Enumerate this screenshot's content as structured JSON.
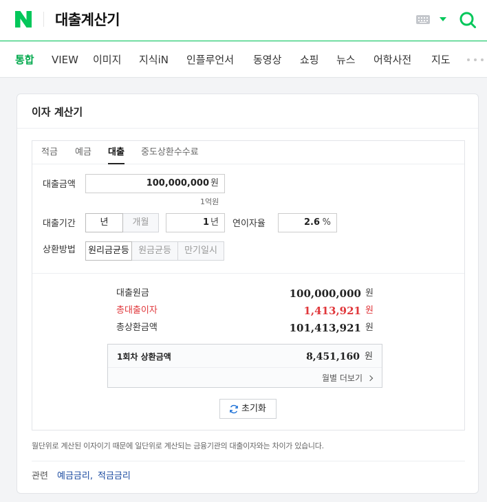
{
  "header": {
    "logo": "N",
    "search_query": "대출계산기",
    "brand_color": "#03c75a"
  },
  "tabs": [
    {
      "label": "통합",
      "active": true
    },
    {
      "label": "VIEW"
    },
    {
      "label": "이미지"
    },
    {
      "label": "지식iN"
    },
    {
      "label": "인플루언서"
    },
    {
      "label": "동영상"
    },
    {
      "label": "쇼핑"
    },
    {
      "label": "뉴스"
    },
    {
      "label": "어학사전"
    },
    {
      "label": "지도"
    }
  ],
  "card": {
    "title": "이자 계산기",
    "calc_tabs": [
      {
        "label": "적금"
      },
      {
        "label": "예금"
      },
      {
        "label": "대출",
        "active": true
      },
      {
        "label": "중도상환수수료"
      }
    ],
    "amount": {
      "label": "대출금액",
      "value": "100,000,000",
      "unit": "원",
      "hint": "1억원"
    },
    "period": {
      "label": "대출기간",
      "unit_options": [
        "년",
        "개월"
      ],
      "selected_unit": "년",
      "value": "1",
      "unit": "년"
    },
    "rate": {
      "label": "연이자율",
      "value": "2.6",
      "unit": "%"
    },
    "method": {
      "label": "상환방법",
      "options": [
        "원리금균등",
        "원금균등",
        "만기일시"
      ],
      "selected": "원리금균등"
    },
    "results": {
      "principal": {
        "label": "대출원금",
        "value": "100,000,000",
        "unit": "원"
      },
      "interest": {
        "label": "총대출이자",
        "value": "1,413,921",
        "unit": "원",
        "color": "#e0373b"
      },
      "total": {
        "label": "총상환금액",
        "value": "101,413,921",
        "unit": "원"
      },
      "first_payment": {
        "label": "1회차 상환금액",
        "value": "8,451,160",
        "unit": "원"
      },
      "monthly_link": "월별 더보기"
    },
    "reset_label": "초기화",
    "notice": "월단위로 계산된 이자이기 때문에 일단위로 계산되는 금융기관의 대출이자와는 차이가 있습니다.",
    "related": {
      "label": "관련",
      "links": [
        "예금금리,",
        "적금금리"
      ]
    }
  }
}
